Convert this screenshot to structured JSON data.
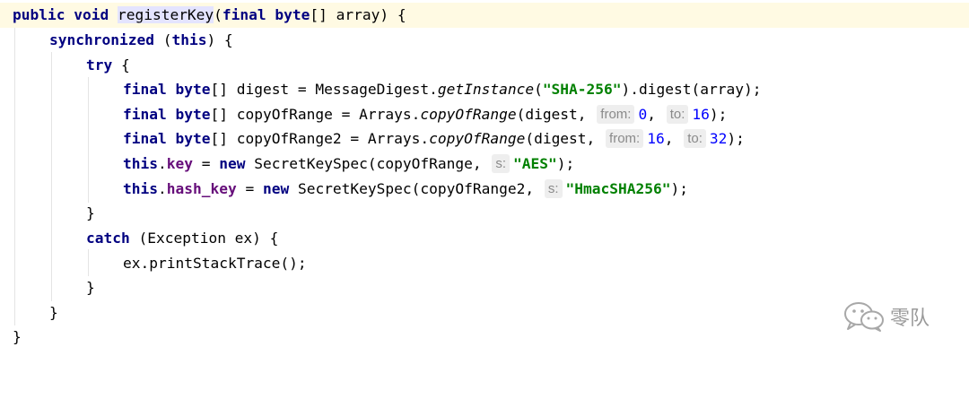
{
  "editor": {
    "language": "java",
    "colors": {
      "keyword": "#000080",
      "field": "#660e7a",
      "string": "#008000",
      "number": "#0000ff",
      "current_line_bg": "#fffae3",
      "identifier_highlight": "#e4e4ff",
      "hint_bg": "#eeeeee",
      "hint_text": "#8a8a8a"
    },
    "lines": {
      "l1": {
        "kw_public": "public",
        "kw_void": "void",
        "method_name": "registerKey",
        "paren_open": "(",
        "kw_final": "final",
        "kw_byte": "byte",
        "rest": "[] array) {"
      },
      "l2": {
        "kw_synchronized": "synchronized",
        "sep1": " (",
        "kw_this": "this",
        "rest": ") {"
      },
      "l3": {
        "kw_try": "try",
        "rest": " {"
      },
      "l4": {
        "kw_final": "final",
        "kw_byte": "byte",
        "mid": "[] digest = MessageDigest.",
        "method": "getInstance",
        "paren": "(",
        "str": "\"SHA-256\"",
        "rest": ").digest(array);"
      },
      "l5": {
        "kw_final": "final",
        "kw_byte": "byte",
        "mid": "[] copyOfRange = Arrays.",
        "method": "copyOfRange",
        "args": "(digest,",
        "hint_from": "from:",
        "num_from": "0",
        "comma": ",",
        "hint_to": "to:",
        "num_to": "16",
        "rest": ");"
      },
      "l6": {
        "kw_final": "final",
        "kw_byte": "byte",
        "mid": "[] copyOfRange2 = Arrays.",
        "method": "copyOfRange",
        "args": "(digest,",
        "hint_from": "from:",
        "num_from": "16",
        "comma": ",",
        "hint_to": "to:",
        "num_to": "32",
        "rest": ");"
      },
      "l7": {
        "kw_this": "this",
        "dot": ".",
        "field": "key",
        "mid": " = ",
        "kw_new": "new",
        "ctor": " SecretKeySpec(copyOfRange,",
        "hint_s": "s:",
        "str": "\"AES\"",
        "rest": ");"
      },
      "l8": {
        "kw_this": "this",
        "dot": ".",
        "field": "hash_key",
        "mid": " = ",
        "kw_new": "new",
        "ctor": " SecretKeySpec(copyOfRange2,",
        "hint_s": "s:",
        "str": "\"HmacSHA256\"",
        "rest": ");"
      },
      "l9": {
        "text": "}"
      },
      "l10": {
        "kw_catch": "catch",
        "rest": " (Exception ex) {"
      },
      "l11": {
        "text": "ex.printStackTrace();"
      },
      "l12": {
        "text": "}"
      },
      "l13": {
        "text": "}"
      },
      "l14": {
        "text": "}"
      }
    }
  },
  "watermark": {
    "icon": "wechat-icon",
    "text": "零队"
  }
}
